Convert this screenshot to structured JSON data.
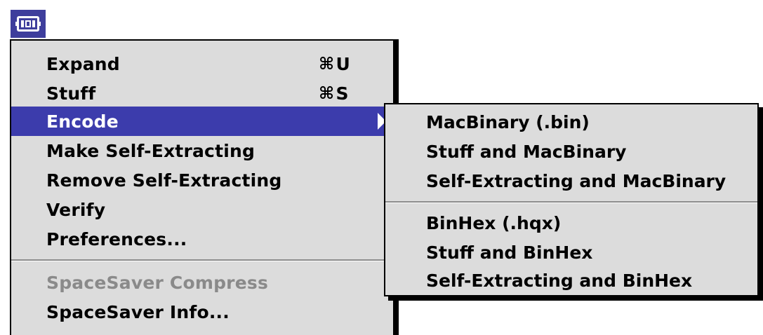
{
  "menubar": {
    "app_icon": "stuffit-app-icon"
  },
  "menu": {
    "items": [
      {
        "label": "Expand",
        "shortcut": "U",
        "cmd_symbol": "⌘"
      },
      {
        "label": "Stuff",
        "shortcut": "S",
        "cmd_symbol": "⌘"
      },
      {
        "label": "Encode",
        "has_submenu": true,
        "selected": true
      },
      {
        "label": "Make Self-Extracting"
      },
      {
        "label": "Remove Self-Extracting"
      },
      {
        "label": "Verify"
      },
      {
        "label": "Preferences..."
      },
      {
        "label": "SpaceSaver Compress",
        "disabled": true
      },
      {
        "label": "SpaceSaver Info..."
      }
    ]
  },
  "submenu": {
    "items": [
      {
        "label": "MacBinary (.bin)"
      },
      {
        "label": "Stuff and MacBinary"
      },
      {
        "label": "Self-Extracting and MacBinary"
      },
      {
        "label": "BinHex (.hqx)"
      },
      {
        "label": "Stuff and BinHex"
      },
      {
        "label": "Self-Extracting and BinHex"
      }
    ]
  },
  "colors": {
    "menu_bg": "#dcdcdc",
    "highlight": "#3c3cac",
    "disabled_text": "#8a8a8a"
  }
}
